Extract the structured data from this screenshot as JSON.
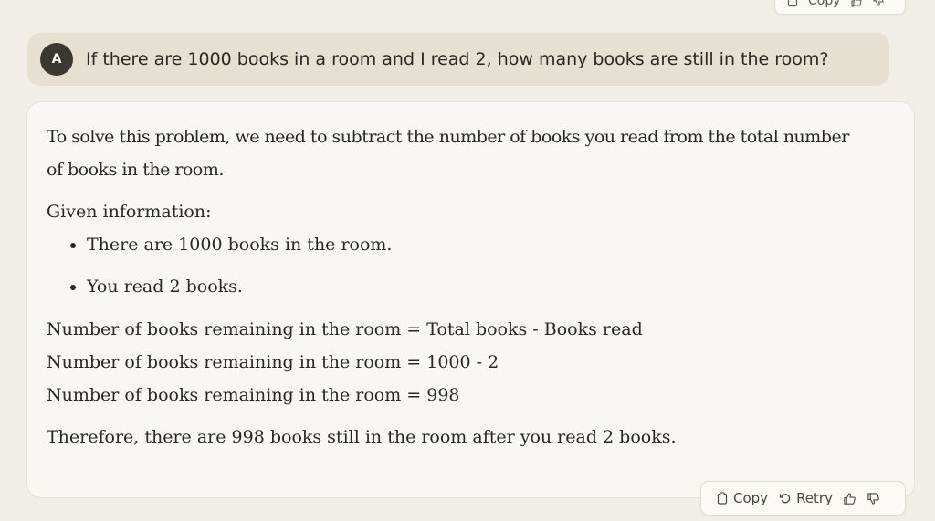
{
  "top_actions": {
    "copy_label": "Copy"
  },
  "user_message": {
    "avatar_initial": "A",
    "text": "If there are 1000 books in a room and I read 2, how many books are still in the room?"
  },
  "assistant_message": {
    "intro": "To solve this problem, we need to subtract the number of books you read from the total number of books in the room.",
    "given_heading": "Given information:",
    "bullets": [
      "There are 1000 books in the room.",
      "You read 2 books."
    ],
    "calculation_lines": [
      "Number of books remaining in the room = Total books - Books read",
      "Number of books remaining in the room = 1000 - 2",
      "Number of books remaining in the room = 998"
    ],
    "conclusion": "Therefore, there are 998 books still in the room after you read 2 books."
  },
  "actions": {
    "copy_label": "Copy",
    "retry_label": "Retry"
  },
  "icons": [
    "clipboard-icon",
    "retry-icon",
    "thumbs-up-icon",
    "thumbs-down-icon"
  ],
  "colors": {
    "background": "#f1eee8",
    "user_bubble": "#e5e0cf",
    "avatar": "#3b382f",
    "card": "#f8f7f4"
  }
}
